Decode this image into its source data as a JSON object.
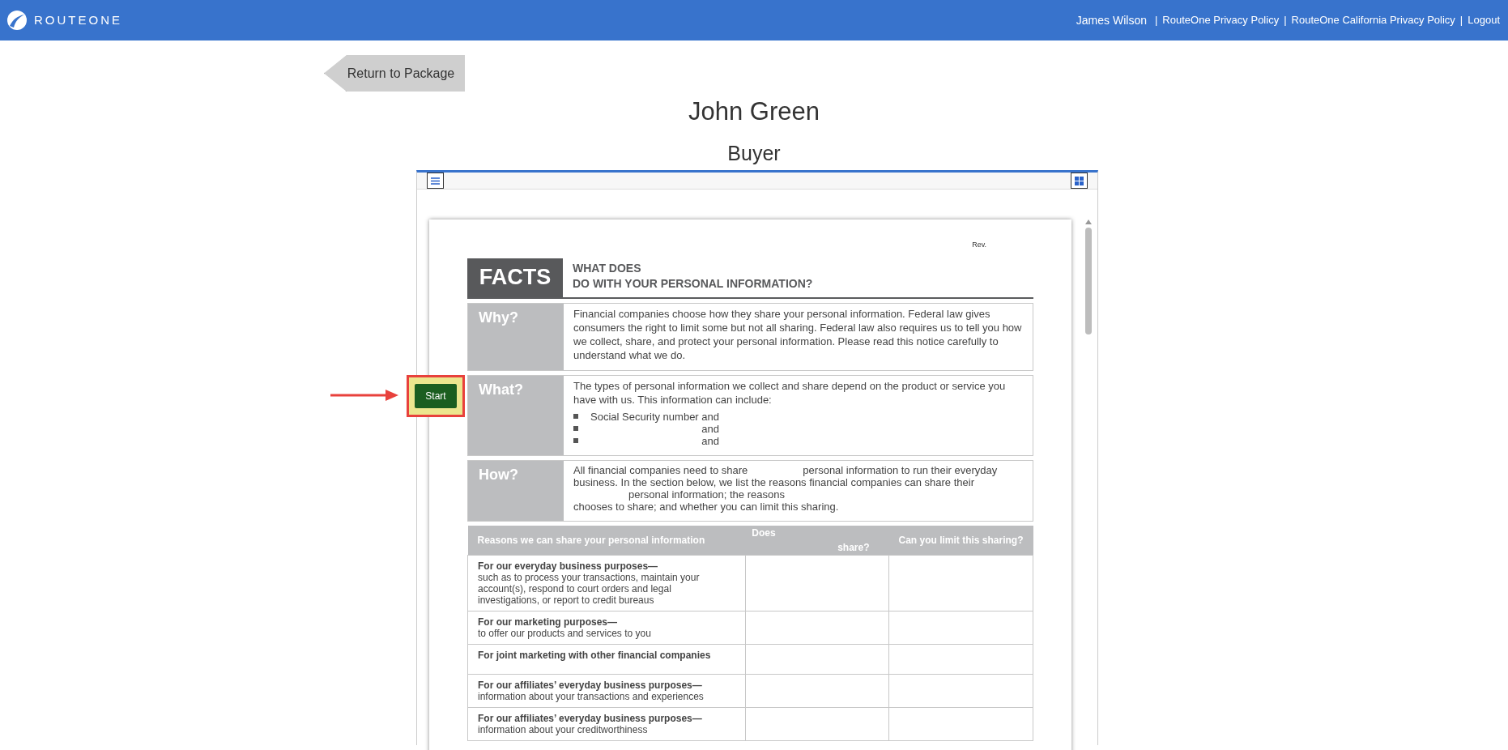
{
  "header": {
    "brand": "ROUTEONE",
    "user": "James Wilson",
    "separator": "|",
    "links": [
      "RouteOne Privacy Policy",
      "RouteOne California Privacy Policy",
      "Logout"
    ]
  },
  "back_button": "Return to Package",
  "person": {
    "name": "John Green",
    "role": "Buyer"
  },
  "start_button": "Start",
  "document": {
    "rev": "Rev.",
    "facts_label": "FACTS",
    "title_lines": [
      "WHAT DOES",
      "DO WITH YOUR PERSONAL INFORMATION?"
    ],
    "sections": [
      {
        "label": "Why?",
        "kind": "paragraph",
        "text": "Financial companies choose how they share your personal information. Federal law gives consumers the right to limit some but not all sharing. Federal law also requires us to tell you how we collect, share, and protect your personal information. Please read this notice carefully to understand what we do."
      },
      {
        "label": "What?",
        "kind": "bullets",
        "text": "The types of personal information we collect and share depend on the product or service you have with us. This information can include:",
        "bullets": [
          "Social Security number and",
          "and",
          "and"
        ]
      },
      {
        "label": "How?",
        "kind": "lines",
        "lines": [
          {
            "indented": false,
            "segments": [
              "All financial companies need to share",
              "personal information to run their everyday"
            ]
          },
          {
            "indented": false,
            "segments": [
              "business. In the section below, we list the reasons financial companies can share their"
            ]
          },
          {
            "indented": true,
            "segments": [
              "personal information; the reasons"
            ]
          },
          {
            "indented": false,
            "segments": [
              "chooses to share; and whether you can limit this sharing."
            ]
          }
        ]
      }
    ],
    "table": {
      "columns": [
        {
          "parts": [
            "Reasons we can share your personal information"
          ]
        },
        {
          "parts": [
            "Does",
            "share?"
          ]
        },
        {
          "parts": [
            "Can you limit this sharing?"
          ]
        }
      ],
      "rows": [
        {
          "title": "For our everyday business purposes—",
          "detail": "such as to process your transactions, maintain your account(s), respond to court orders and legal investigations, or report to credit bureaus"
        },
        {
          "title": "For our marketing purposes—",
          "detail": "to offer our products and services to you"
        },
        {
          "title": "For joint marketing with other financial companies"
        },
        {
          "title": "For our affiliates’ everyday business purposes—",
          "detail": "information about your transactions and experiences"
        },
        {
          "title": "For our affiliates’ everyday business purposes—",
          "detail": "information about your creditworthiness"
        }
      ]
    }
  }
}
